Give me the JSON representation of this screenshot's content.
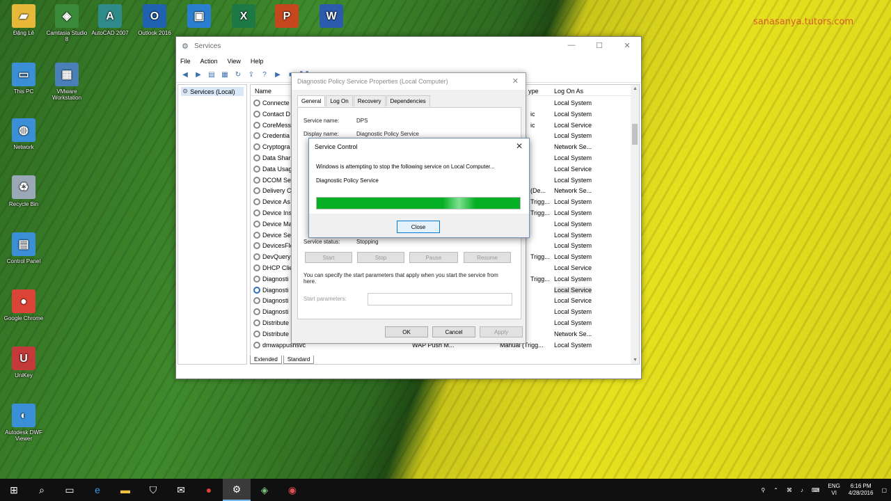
{
  "watermark": "sanasanya.tutors.com",
  "desktop_icons": [
    {
      "label": "Đặng Lê",
      "icon": "folder-icon",
      "color": "#e8b83a"
    },
    {
      "label": "Camtasia Studio 8",
      "icon": "camtasia-icon",
      "color": "#3a8a3a"
    },
    {
      "label": "AutoCAD 2007",
      "icon": "autocad-icon",
      "color": "#2f8a8a"
    },
    {
      "label": "Outlook 2016",
      "icon": "outlook-icon",
      "color": "#1e62b0"
    },
    {
      "label": "",
      "icon": "remote-desktop-icon",
      "color": "#2b7fd1"
    },
    {
      "label": "",
      "icon": "excel-icon",
      "color": "#1e7a45"
    },
    {
      "label": "",
      "icon": "powerpoint-icon",
      "color": "#c6461e"
    },
    {
      "label": "",
      "icon": "word-icon",
      "color": "#2a5bac"
    },
    {
      "label": "This PC",
      "icon": "this-pc-icon",
      "color": "#3b8fd6"
    },
    {
      "label": "VMware Workstation",
      "icon": "vmware-icon",
      "color": "#4a7fb8"
    },
    {
      "label": "Network",
      "icon": "network-icon",
      "color": "#3b8fd6"
    },
    {
      "label": "Recycle Bin",
      "icon": "recycle-bin-icon",
      "color": "#9aa8b8"
    },
    {
      "label": "Control Panel",
      "icon": "control-panel-icon",
      "color": "#3b8fd6"
    },
    {
      "label": "Google Chrome",
      "icon": "chrome-icon",
      "color": "#db4437"
    },
    {
      "label": "UniKey",
      "icon": "unikey-icon",
      "color": "#c43a3a"
    },
    {
      "label": "Autodesk DWF Viewer",
      "icon": "dwf-viewer-icon",
      "color": "#3b8fd6"
    }
  ],
  "services_window": {
    "title": "Services",
    "menu": [
      "File",
      "Action",
      "View",
      "Help"
    ],
    "tree_root": "Services (Local)",
    "columns": {
      "name": "Name",
      "type": "ype",
      "logon": "Log On As"
    },
    "rows": [
      {
        "name": "Connecte",
        "startup": "",
        "logon": "Local System"
      },
      {
        "name": "Contact D",
        "startup": "ic",
        "logon": "Local System"
      },
      {
        "name": "CoreMess",
        "startup": "ic",
        "logon": "Local Service"
      },
      {
        "name": "Credentia",
        "startup": "",
        "logon": "Local System"
      },
      {
        "name": "Cryptogra",
        "startup": "",
        "logon": "Network Se..."
      },
      {
        "name": "Data Shar",
        "startup": "",
        "logon": "Local System"
      },
      {
        "name": "Data Usag",
        "startup": "",
        "logon": "Local Service"
      },
      {
        "name": "DCOM Se",
        "startup": "",
        "logon": "Local System"
      },
      {
        "name": "Delivery C",
        "startup": "(De...",
        "logon": "Network Se..."
      },
      {
        "name": "Device As",
        "startup": "Trigg...",
        "logon": "Local System"
      },
      {
        "name": "Device Ins",
        "startup": "Trigg...",
        "logon": "Local System"
      },
      {
        "name": "Device Ma",
        "startup": "",
        "logon": "Local System"
      },
      {
        "name": "Device Set",
        "startup": "",
        "logon": "Local System"
      },
      {
        "name": "DevicesFlo",
        "startup": "",
        "logon": "Local System"
      },
      {
        "name": "DevQuery",
        "startup": "Trigg...",
        "logon": "Local System"
      },
      {
        "name": "DHCP Clie",
        "startup": "",
        "logon": "Local Service"
      },
      {
        "name": "Diagnosti",
        "startup": "Trigg...",
        "logon": "Local System"
      },
      {
        "name": "Diagnosti",
        "startup": "",
        "logon": "Local Service"
      },
      {
        "name": "Diagnosti",
        "startup": "",
        "logon": "Local Service"
      },
      {
        "name": "Diagnosti",
        "startup": "",
        "logon": "Local System"
      },
      {
        "name": "Distribute",
        "startup": "",
        "logon": "Local System"
      },
      {
        "name": "Distribute",
        "startup": "",
        "logon": "Network Se..."
      },
      {
        "name": "dmwappushsvc",
        "desc": "WAP Push M...",
        "startup": "Manual (Trigg...",
        "logon": "Local System"
      }
    ],
    "bottom_tabs": [
      "Extended",
      "Standard"
    ]
  },
  "properties_dialog": {
    "title": "Diagnostic Policy Service Properties (Local Computer)",
    "tabs": [
      "General",
      "Log On",
      "Recovery",
      "Dependencies"
    ],
    "service_name_label": "Service name:",
    "service_name_value": "DPS",
    "display_name_label": "Display name:",
    "display_name_value": "Diagnostic Policy Service",
    "status_label": "Service status:",
    "status_value": "Stopping",
    "buttons": {
      "start": "Start",
      "stop": "Stop",
      "pause": "Pause",
      "resume": "Resume"
    },
    "hint": "You can specify the start parameters that apply when you start the service from here.",
    "start_params_label": "Start parameters:",
    "ok": "OK",
    "cancel": "Cancel",
    "apply": "Apply"
  },
  "service_control": {
    "title": "Service Control",
    "message": "Windows is attempting to stop the following service on Local Computer...",
    "service": "Diagnostic Policy Service",
    "progress": 1.0,
    "close_label": "Close"
  },
  "taskbar": {
    "items": [
      "start-icon",
      "search-icon",
      "task-view-icon",
      "edge-icon",
      "file-explorer-icon",
      "store-icon",
      "mail-icon",
      "chrome-icon",
      "services-icon",
      "camtasia-icon",
      "camtasia-recorder-icon"
    ],
    "language": "ENG",
    "region": "VI",
    "time": "6:16 PM",
    "date": "4/28/2016"
  }
}
